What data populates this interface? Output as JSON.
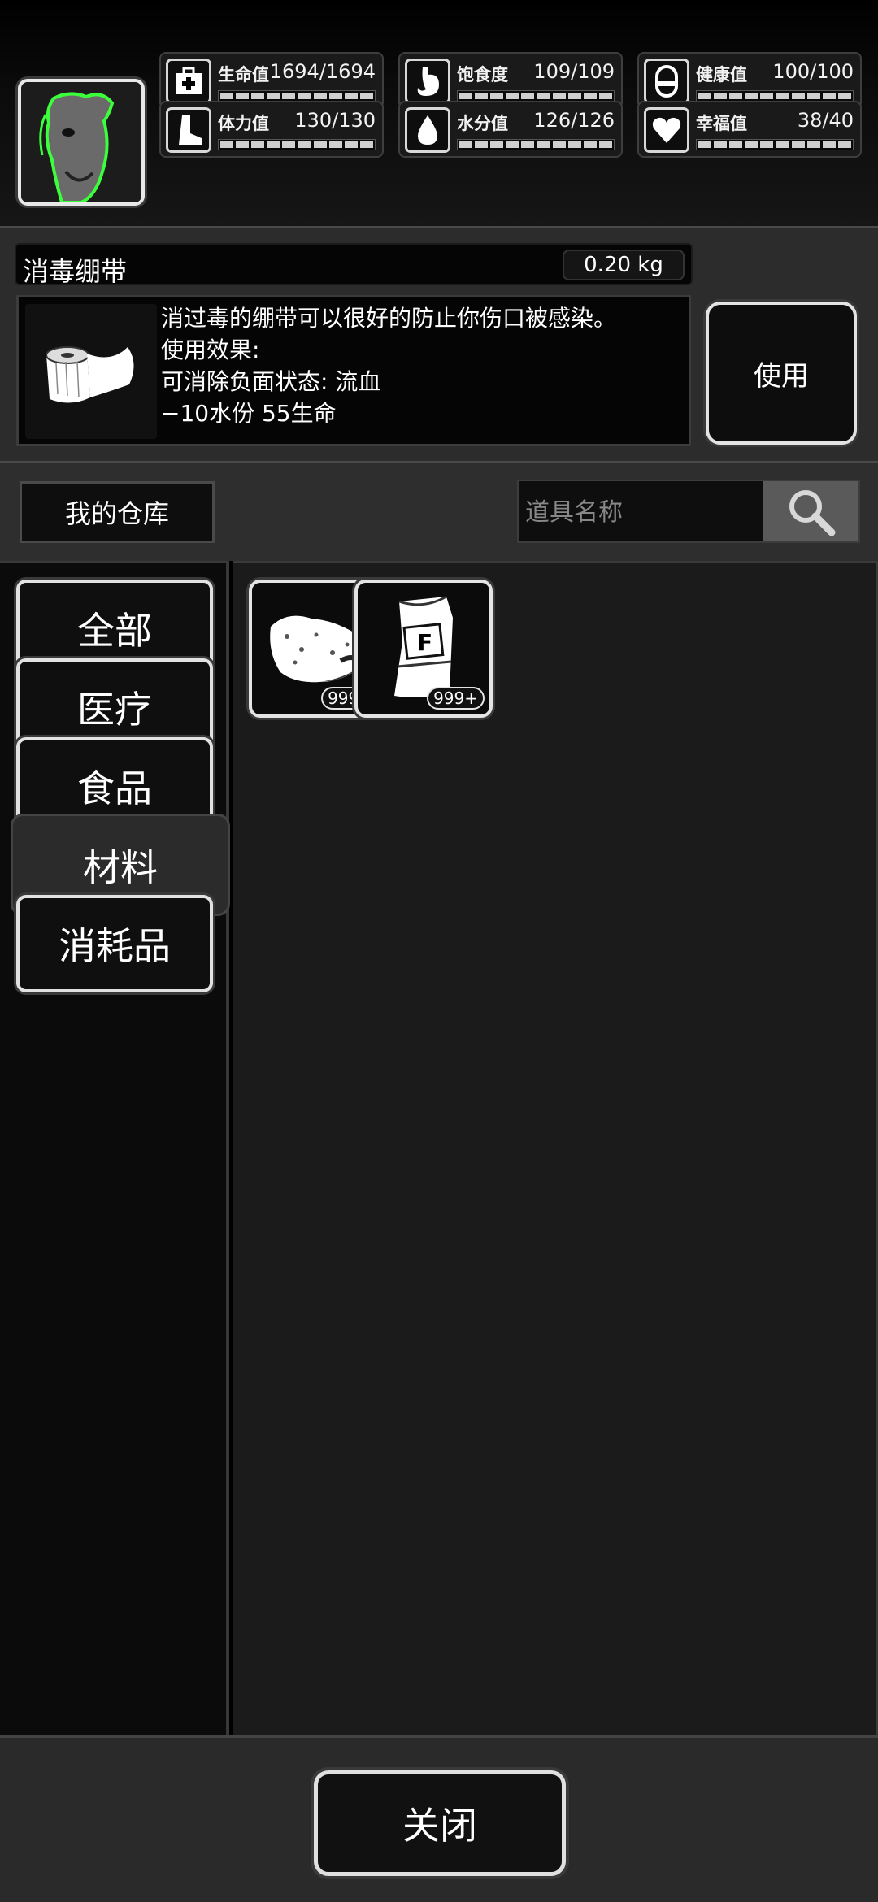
{
  "stats": [
    {
      "label": "生命值",
      "value": "1694/1694",
      "icon": "medkit-icon",
      "fill": 1.0
    },
    {
      "label": "饱食度",
      "value": "109/109",
      "icon": "stomach-icon",
      "fill": 1.0
    },
    {
      "label": "健康值",
      "value": "100/100",
      "icon": "pill-icon",
      "fill": 1.0
    },
    {
      "label": "体力值",
      "value": "130/130",
      "icon": "boot-icon",
      "fill": 1.0
    },
    {
      "label": "水分值",
      "value": "126/126",
      "icon": "water-drop-icon",
      "fill": 1.0
    },
    {
      "label": "幸福值",
      "value": "38/40",
      "icon": "heart-icon",
      "fill": 0.95
    }
  ],
  "selected_item": {
    "name": "消毒绷带",
    "weight": "0.20 kg",
    "description": [
      "消过毒的绷带可以很好的防止你伤口被感染。",
      "使用效果:",
      "可消除负面状态: 流血",
      "−10水份 55生命"
    ],
    "icon": "bandage-icon"
  },
  "use_button": "使用",
  "warehouse": {
    "title": "我的仓库",
    "search_placeholder": "道具名称"
  },
  "categories": [
    {
      "label": "全部",
      "active": false
    },
    {
      "label": "医疗",
      "active": false
    },
    {
      "label": "食品",
      "active": false
    },
    {
      "label": "材料",
      "active": true
    },
    {
      "label": "消耗品",
      "active": false
    }
  ],
  "items": [
    {
      "icon": "meat-icon",
      "qty": "999+"
    },
    {
      "icon": "fertilizer-bag-icon",
      "qty": "999+"
    }
  ],
  "close_button": "关闭",
  "colors": {
    "accent_glow": "#3cff3c",
    "background": "#1b1b1b",
    "border": "#e2e2e2"
  }
}
